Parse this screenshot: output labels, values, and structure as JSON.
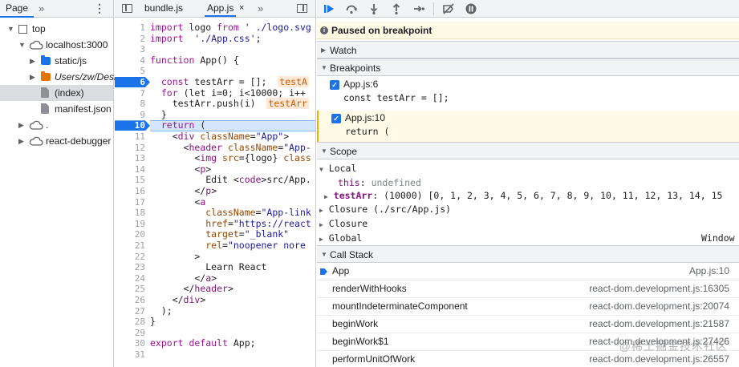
{
  "navigator": {
    "tab_label": "Page",
    "more_label": "»",
    "tree": [
      {
        "label": "top",
        "depth": 0,
        "expanded": true,
        "icon": "frame-icon"
      },
      {
        "label": "localhost:3000",
        "depth": 1,
        "expanded": true,
        "icon": "cloud-icon"
      },
      {
        "label": "static/js",
        "depth": 2,
        "expanded": false,
        "icon": "folder-icon",
        "color": "#1a73e8"
      },
      {
        "label": "Users/zw/Desk",
        "depth": 2,
        "expanded": false,
        "icon": "folder-icon",
        "color": "#e37400",
        "italic": true
      },
      {
        "label": "(index)",
        "depth": 2,
        "icon": "file-icon",
        "selected": true
      },
      {
        "label": "manifest.json",
        "depth": 2,
        "icon": "file-icon"
      },
      {
        "label": ".",
        "depth": 1,
        "expanded": false,
        "icon": "cloud-icon"
      },
      {
        "label": "react-debugger",
        "depth": 1,
        "expanded": false,
        "icon": "cloud-icon"
      }
    ]
  },
  "editor": {
    "tabs": [
      "bundle.js",
      "App.js"
    ],
    "active_tab": "App.js",
    "close_label": "×",
    "more_label": "»",
    "breakpoint_lines": [
      6,
      10
    ],
    "paused_line": 10,
    "lines": [
      [
        [
          "kw",
          "import"
        ],
        [
          "",
          "logo "
        ],
        [
          "kw",
          "from"
        ],
        [
          "",
          "' "
        ],
        [
          "str",
          "./logo.svg"
        ]
      ],
      [
        [
          "kw",
          "import"
        ],
        [
          "str",
          " './App.css'"
        ],
        [
          "",
          ";"
        ]
      ],
      [],
      [
        [
          "kw",
          "function"
        ],
        [
          "",
          ""
        ],
        [
          "",
          "App() {"
        ]
      ],
      [],
      [
        [
          "",
          "  "
        ],
        [
          "kw",
          "const"
        ],
        [
          "",
          "testArr = [];  "
        ],
        [
          "inl",
          "testA"
        ]
      ],
      [
        [
          "",
          "  "
        ],
        [
          "kw",
          "for"
        ],
        [
          "",
          "(let i=0; i<10000; i++"
        ]
      ],
      [
        [
          "",
          "    testArr.push(i)  "
        ],
        [
          "inl",
          "testArr"
        ]
      ],
      [
        [
          "",
          "  }"
        ]
      ],
      [
        [
          "",
          "  "
        ],
        [
          "kw",
          "return"
        ],
        [
          "",
          "("
        ]
      ],
      [
        [
          "",
          "    <"
        ],
        [
          "tag",
          "div"
        ],
        [
          "attr",
          " className"
        ],
        [
          "",
          "="
        ],
        [
          "aval",
          "\"App\""
        ],
        [
          "",
          ">"
        ]
      ],
      [
        [
          "",
          "      <"
        ],
        [
          "tag",
          "header"
        ],
        [
          "attr",
          " className"
        ],
        [
          "",
          "="
        ],
        [
          "aval",
          "\"App-"
        ]
      ],
      [
        [
          "",
          "        <"
        ],
        [
          "tag",
          "img"
        ],
        [
          "attr",
          " src"
        ],
        [
          "",
          "={logo} "
        ],
        [
          "attr",
          "class"
        ]
      ],
      [
        [
          "",
          "        <"
        ],
        [
          "tag",
          "p"
        ],
        [
          "",
          ">"
        ]
      ],
      [
        [
          "",
          "          Edit <"
        ],
        [
          "tag",
          "code"
        ],
        [
          "",
          ">src/App."
        ]
      ],
      [
        [
          "",
          "        </"
        ],
        [
          "tag",
          "p"
        ],
        [
          "",
          ">"
        ]
      ],
      [
        [
          "",
          "        <"
        ],
        [
          "tag",
          "a"
        ]
      ],
      [
        [
          "attr",
          "          className"
        ],
        [
          "",
          "="
        ],
        [
          "aval",
          "\"App-link"
        ]
      ],
      [
        [
          "attr",
          "          href"
        ],
        [
          "",
          "="
        ],
        [
          "aval",
          "\"https://react"
        ]
      ],
      [
        [
          "attr",
          "          target"
        ],
        [
          "",
          "="
        ],
        [
          "aval",
          "\"_blank\""
        ]
      ],
      [
        [
          "attr",
          "          rel"
        ],
        [
          "",
          "="
        ],
        [
          "aval",
          "\"noopener nore"
        ]
      ],
      [
        [
          "",
          "        >"
        ]
      ],
      [
        [
          "",
          "          Learn React"
        ]
      ],
      [
        [
          "",
          "        </"
        ],
        [
          "tag",
          "a"
        ],
        [
          "",
          ">"
        ]
      ],
      [
        [
          "",
          "      </"
        ],
        [
          "tag",
          "header"
        ],
        [
          "",
          ">"
        ]
      ],
      [
        [
          "",
          "    </"
        ],
        [
          "tag",
          "div"
        ],
        [
          "",
          ">"
        ]
      ],
      [
        [
          "",
          "  );"
        ]
      ],
      [
        [
          "",
          "}"
        ]
      ],
      [],
      [
        [
          "kw",
          "export default"
        ],
        [
          "",
          "App;"
        ]
      ],
      []
    ]
  },
  "debugger": {
    "paused_message": "Paused on breakpoint",
    "sections": {
      "watch": "Watch",
      "breakpoints": "Breakpoints",
      "scope": "Scope",
      "call_stack": "Call Stack"
    },
    "breakpoints": [
      {
        "file": "App.js:6",
        "code": "const testArr = [];",
        "active": false
      },
      {
        "file": "App.js:10",
        "code": "return (",
        "active": true
      }
    ],
    "scope": {
      "local_label": "Local",
      "this_name": "this",
      "this_value": "undefined",
      "testArr_name": "testArr",
      "testArr_value": "(10000) [0, 1, 2, 3, 4, 5, 6, 7, 8, 9, 10, 11, 12, 13, 14, 15",
      "closure_app": "Closure (./src/App.js)",
      "closure": "Closure",
      "global": "Global",
      "global_value": "Window"
    },
    "call_stack": [
      {
        "fn": "App",
        "loc": "App.js:10",
        "current": true
      },
      {
        "fn": "renderWithHooks",
        "loc": "react-dom.development.js:16305"
      },
      {
        "fn": "mountIndeterminateComponent",
        "loc": "react-dom.development.js:20074"
      },
      {
        "fn": "beginWork",
        "loc": "react-dom.development.js:21587"
      },
      {
        "fn": "beginWork$1",
        "loc": "react-dom.development.js:27426"
      },
      {
        "fn": "performUnitOfWork",
        "loc": "react-dom.development.js:26557"
      }
    ],
    "watermark": "@稀土掘金技术社区"
  },
  "colors": {
    "accent": "#1a73e8",
    "paused_bg": "#fffbe6",
    "toolbar_bg": "#f1f3f4"
  }
}
